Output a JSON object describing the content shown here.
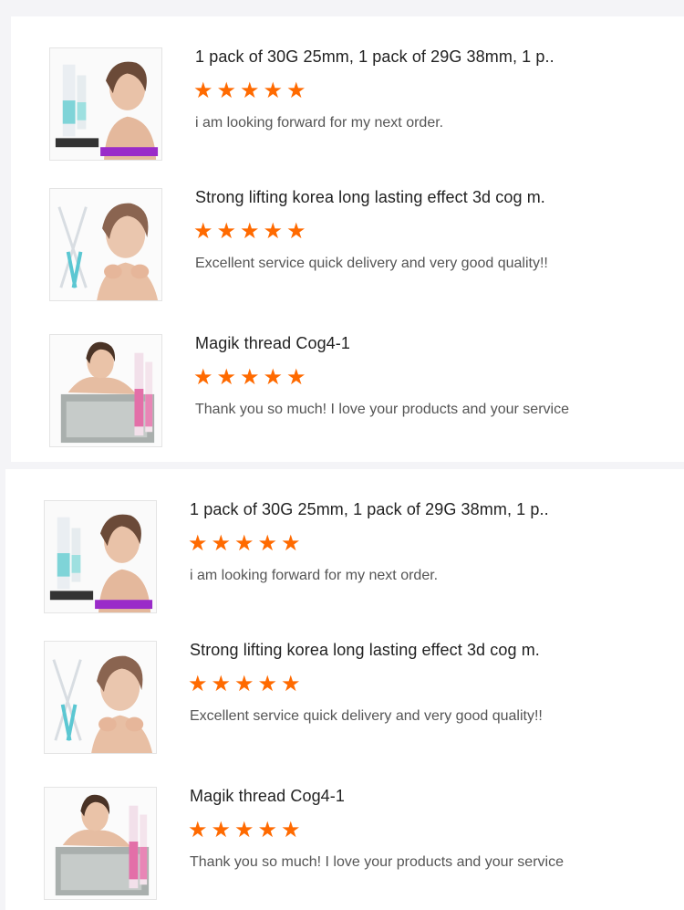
{
  "colors": {
    "star": "#ff6a00",
    "title": "#222222",
    "comment": "#555555",
    "background": "#f4f4f7"
  },
  "star_glyph": "★",
  "panels": [
    {
      "reviews": [
        {
          "title": "1 pack of 30G 25mm, 1 pack of 29G 38mm, 1 p..",
          "rating": 5,
          "comment": "i am looking forward for my next order.",
          "image": "product-thumbnail-cannula-pack"
        },
        {
          "title": "Strong lifting korea long lasting effect 3d cog m.",
          "rating": 5,
          "comment": "Excellent service quick delivery and very good quality!!",
          "image": "product-thumbnail-cog-thread"
        },
        {
          "title": "Magik thread Cog4-1",
          "rating": 5,
          "comment": "Thank you so much! I love your products and your service",
          "image": "product-thumbnail-magik-thread"
        }
      ]
    },
    {
      "reviews": [
        {
          "title": "1 pack of 30G 25mm, 1 pack of 29G 38mm, 1 p..",
          "rating": 5,
          "comment": "i am looking forward for my next order.",
          "image": "product-thumbnail-cannula-pack"
        },
        {
          "title": "Strong lifting korea long lasting effect 3d cog m.",
          "rating": 5,
          "comment": "Excellent service quick delivery and very good quality!!",
          "image": "product-thumbnail-cog-thread"
        },
        {
          "title": "Magik thread Cog4-1",
          "rating": 5,
          "comment": "Thank you so much! I love your products and your service",
          "image": "product-thumbnail-magik-thread"
        }
      ]
    }
  ]
}
